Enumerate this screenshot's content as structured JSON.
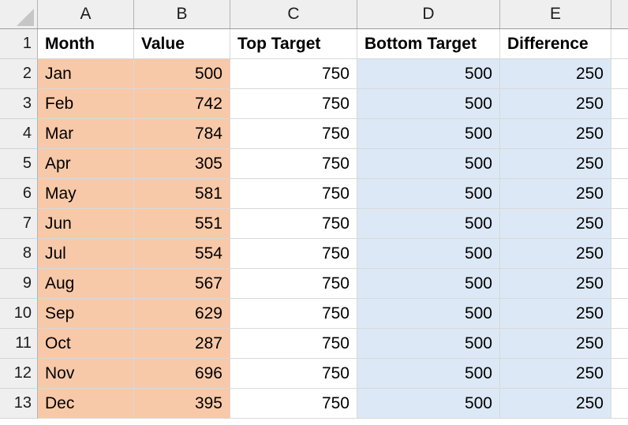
{
  "app": {
    "type": "spreadsheet",
    "select_all_corner": "select-all-triangle"
  },
  "colors": {
    "fill_orange": "#F8C9A8",
    "fill_blue": "#DCE8F5",
    "header_band": "#EFEFEF",
    "gridline": "#D9D9D9",
    "header_border": "#B4B4B4",
    "text": "#000000"
  },
  "column_letters": [
    "A",
    "B",
    "C",
    "D",
    "E"
  ],
  "row_numbers": [
    "1",
    "2",
    "3",
    "4",
    "5",
    "6",
    "7",
    "8",
    "9",
    "10",
    "11",
    "12",
    "13"
  ],
  "table": {
    "headers": [
      "Month",
      "Value",
      "Top Target",
      "Bottom Target",
      "Difference"
    ],
    "rows": [
      {
        "month": "Jan",
        "value": "500",
        "top_target": "750",
        "bottom_target": "500",
        "difference": "250"
      },
      {
        "month": "Feb",
        "value": "742",
        "top_target": "750",
        "bottom_target": "500",
        "difference": "250"
      },
      {
        "month": "Mar",
        "value": "784",
        "top_target": "750",
        "bottom_target": "500",
        "difference": "250"
      },
      {
        "month": "Apr",
        "value": "305",
        "top_target": "750",
        "bottom_target": "500",
        "difference": "250"
      },
      {
        "month": "May",
        "value": "581",
        "top_target": "750",
        "bottom_target": "500",
        "difference": "250"
      },
      {
        "month": "Jun",
        "value": "551",
        "top_target": "750",
        "bottom_target": "500",
        "difference": "250"
      },
      {
        "month": "Jul",
        "value": "554",
        "top_target": "750",
        "bottom_target": "500",
        "difference": "250"
      },
      {
        "month": "Aug",
        "value": "567",
        "top_target": "750",
        "bottom_target": "500",
        "difference": "250"
      },
      {
        "month": "Sep",
        "value": "629",
        "top_target": "750",
        "bottom_target": "500",
        "difference": "250"
      },
      {
        "month": "Oct",
        "value": "287",
        "top_target": "750",
        "bottom_target": "500",
        "difference": "250"
      },
      {
        "month": "Nov",
        "value": "696",
        "top_target": "750",
        "bottom_target": "500",
        "difference": "250"
      },
      {
        "month": "Dec",
        "value": "395",
        "top_target": "750",
        "bottom_target": "500",
        "difference": "250"
      }
    ]
  },
  "chart_data": {
    "type": "table",
    "title": "",
    "categories": [
      "Jan",
      "Feb",
      "Mar",
      "Apr",
      "May",
      "Jun",
      "Jul",
      "Aug",
      "Sep",
      "Oct",
      "Nov",
      "Dec"
    ],
    "series": [
      {
        "name": "Value",
        "values": [
          500,
          742,
          784,
          305,
          581,
          551,
          554,
          567,
          629,
          287,
          696,
          395
        ]
      },
      {
        "name": "Top Target",
        "values": [
          750,
          750,
          750,
          750,
          750,
          750,
          750,
          750,
          750,
          750,
          750,
          750
        ]
      },
      {
        "name": "Bottom Target",
        "values": [
          500,
          500,
          500,
          500,
          500,
          500,
          500,
          500,
          500,
          500,
          500,
          500
        ]
      },
      {
        "name": "Difference",
        "values": [
          250,
          250,
          250,
          250,
          250,
          250,
          250,
          250,
          250,
          250,
          250,
          250
        ]
      }
    ],
    "xlabel": "Month",
    "ylabel": ""
  }
}
